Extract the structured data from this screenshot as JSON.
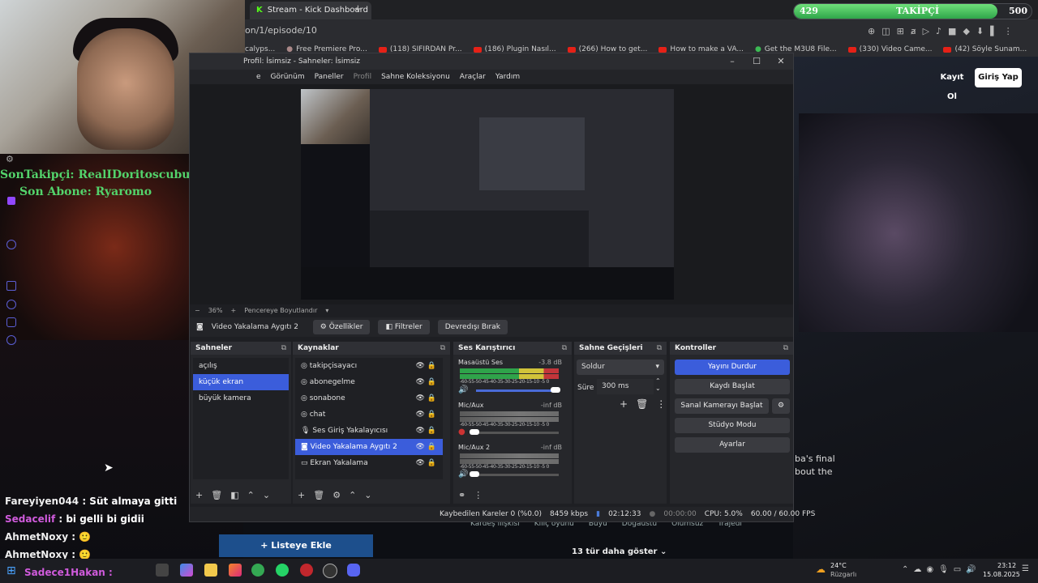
{
  "browser": {
    "tab_title": "Stream - Kick Dashboard",
    "url_fragment": "on/1/episode/10",
    "bookmarks": [
      "calyps...",
      "Free Premiere Pro...",
      "(118) SIFIRDAN Pr...",
      "(186) Plugin Nasıl...",
      "(266) How to get...",
      "How to make a VA...",
      "Get the M3U8 File...",
      "(330) Video Came...",
      "(42) Söyle Sunam..."
    ]
  },
  "follow_bar": {
    "current": "429",
    "label": "TAKİPÇİ",
    "goal": "500",
    "progress": 0.858
  },
  "kick": {
    "register": "Kayıt Ol",
    "login": "Giriş Yap",
    "add_list": "Listeye Ekle",
    "tags": [
      "Kardeş ilişkisi",
      "Kılıç oyunu",
      "Büyü",
      "Doğaüstü",
      "Ölümsüz",
      "Trajedi"
    ],
    "more": "13 tür daha göster",
    "desc_line1": "ba's final",
    "desc_line2": "bout the"
  },
  "overlay": {
    "last_follower": "SonTakipçi: RealIDoritoscubun",
    "last_sub": "Son Abone: Ryaromo"
  },
  "obs": {
    "title": "Profil: İsimsiz - Sahneler: İsimsiz",
    "menu": [
      "e",
      "Görünüm",
      "Paneller",
      "Profil",
      "Sahne Koleksiyonu",
      "Araçlar",
      "Yardım"
    ],
    "zoom": "36%",
    "fit": "Pencereye Boyutlandır",
    "source_name": "Video Yakalama Aygıtı 2",
    "props": "Özellikler",
    "filters": "Filtreler",
    "deactivate": "Devredışı Bırak",
    "scenes_title": "Sahneler",
    "scenes": [
      "açılış",
      "küçük ekran",
      "büyük kamera"
    ],
    "selected_scene": 1,
    "sources_title": "Kaynaklar",
    "sources": [
      "takipçisayacı",
      "abonegelme",
      "sonabone",
      "chat",
      "Ses Giriş Yakalayıcısı",
      "Video Yakalama Aygıtı 2",
      "Ekran Yakalama"
    ],
    "selected_source": 5,
    "mixer_title": "Ses Karıştırıcı",
    "mixer": [
      {
        "name": "Masaüstü Ses",
        "db": "-3.8 dB",
        "level": 0.88
      },
      {
        "name": "Mic/Aux",
        "db": "-inf dB",
        "level": 0.0
      },
      {
        "name": "Mic/Aux 2",
        "db": "-inf dB",
        "level": 0.0
      }
    ],
    "meter_ticks": "-60-55-50-45-40-35-30-25-20-15-10 -5 0",
    "transitions_title": "Sahne Geçişleri",
    "transition": "Soldur",
    "duration_label": "Süre",
    "duration": "300 ms",
    "controls_title": "Kontroller",
    "controls": [
      "Yayını Durdur",
      "Kaydı Başlat",
      "Sanal Kamerayı Başlat",
      "Stüdyo Modu",
      "Ayarlar"
    ],
    "status": {
      "dropped": "Kaybedilen Kareler 0 (%0.0)",
      "bitrate": "8459 kbps",
      "live_time": "02:12:33",
      "rec_time": "00:00:00",
      "cpu": "CPU: 5.0%",
      "fps": "60.00 / 60.00 FPS"
    }
  },
  "chat": [
    {
      "user": "Fareyiyen044",
      "msg": "Süt almaya gitti"
    },
    {
      "user": "Sedacelif",
      "msg": "bi gelli bi gidii"
    },
    {
      "user": "AhmetNoxy",
      "msg": ""
    },
    {
      "user": "AhmetNoxy",
      "msg": ""
    },
    {
      "user": "Sadece1Hakan",
      "msg": ""
    }
  ],
  "taskbar": {
    "temp": "24°C",
    "weather": "Rüzgarlı",
    "time": "23:12",
    "date": "15.08.2025"
  }
}
